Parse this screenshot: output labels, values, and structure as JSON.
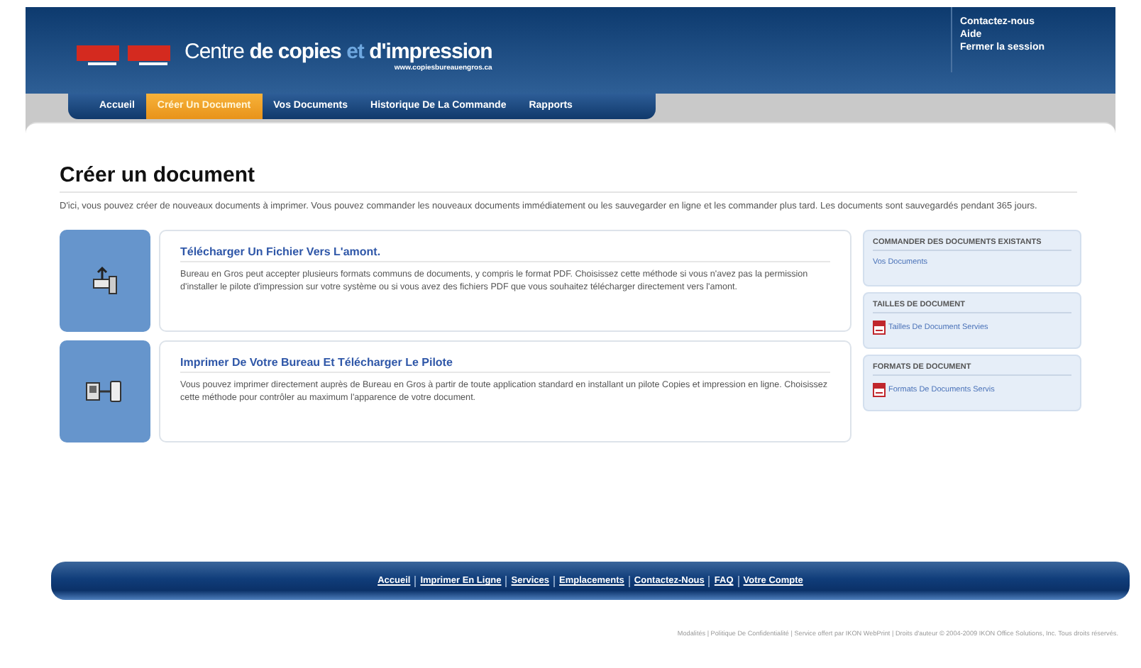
{
  "header": {
    "logo_title": {
      "plain": "Centre ",
      "bold": "de copies ",
      "accent": "et",
      "bold2": " d'impression"
    },
    "logo_url": "www.copiesbureauengros.ca",
    "links": [
      "Contactez-nous",
      "Aide",
      "Fermer la session"
    ]
  },
  "tabs": [
    {
      "label": "Accueil",
      "selected": false
    },
    {
      "label": "Créer Un Document",
      "selected": true
    },
    {
      "label": "Vos Documents",
      "selected": false
    },
    {
      "label": "Historique De La Commande",
      "selected": false
    },
    {
      "label": "Rapports",
      "selected": false
    }
  ],
  "page": {
    "title": "Créer un document",
    "intro": "D'ici, vous pouvez créer de nouveaux documents à imprimer. Vous pouvez commander les nouveaux documents immédiatement ou les sauvegarder en ligne et les commander plus tard. Les documents sont sauvegardés pendant 365 jours."
  },
  "options": [
    {
      "kind": "upload",
      "title": "Télécharger Un Fichier Vers L'amont.",
      "text": "Bureau en Gros peut accepter plusieurs formats communs de documents, y compris le format PDF. Choisissez cette méthode si vous n'avez pas la permission d'installer le pilote d'impression sur votre système ou si vous avez des fichiers PDF que vous souhaitez télécharger directement vers l'amont."
    },
    {
      "kind": "driver",
      "title": "Imprimer De Votre Bureau Et Télécharger Le Pilote",
      "text": "Vous pouvez imprimer directement auprès de Bureau en Gros à partir de toute application standard en installant un pilote Copies et impression en ligne. Choisissez cette méthode pour contrôler au maximum l'apparence de votre document."
    }
  ],
  "sidebar": [
    {
      "heading": "COMMANDER DES DOCUMENTS EXISTANTS",
      "link": "Vos Documents",
      "kind": "plain"
    },
    {
      "heading": "TAILLES DE DOCUMENT",
      "link": "Tailles De Document Servies",
      "kind": "pdf"
    },
    {
      "heading": "FORMATS DE DOCUMENT",
      "link": "Formats De Documents Servis",
      "kind": "pdf"
    }
  ],
  "footer": {
    "links": [
      "Accueil",
      "Imprimer En Ligne",
      "Services",
      "Emplacements",
      "Contactez-Nous",
      "FAQ",
      "Votre Compte"
    ],
    "legal": "Modalités | Politique De Confidentialité | Service offert par IKON WebPrint | Droits d'auteur © 2004-2009 IKON Office Solutions, Inc. Tous droits réservés."
  }
}
